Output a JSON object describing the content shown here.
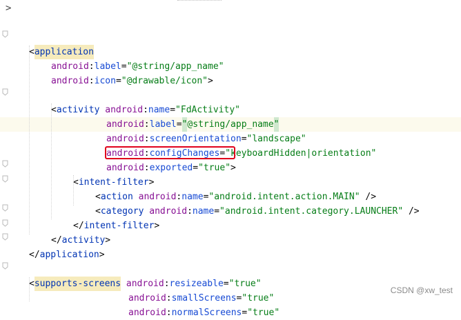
{
  "editor": {
    "collapsed_marker": ">",
    "lines": [
      {
        "indent": 0,
        "parts": []
      },
      {
        "indent": 0,
        "parts": [
          {
            "t": "br",
            "v": "<"
          },
          {
            "t": "tag hl",
            "v": "application"
          }
        ]
      },
      {
        "indent": 1,
        "parts": [
          {
            "t": "ns",
            "v": "android"
          },
          {
            "t": "br",
            "v": ":"
          },
          {
            "t": "attr",
            "v": "label"
          },
          {
            "t": "br",
            "v": "="
          },
          {
            "t": "val",
            "v": "\"@string/app_name\""
          }
        ]
      },
      {
        "indent": 1,
        "parts": [
          {
            "t": "ns",
            "v": "android"
          },
          {
            "t": "br",
            "v": ":"
          },
          {
            "t": "attr",
            "v": "icon"
          },
          {
            "t": "br",
            "v": "="
          },
          {
            "t": "val",
            "v": "\"@drawable/icon\""
          },
          {
            "t": "br",
            "v": ">"
          }
        ]
      },
      {
        "indent": 0,
        "parts": []
      },
      {
        "indent": 1,
        "parts": [
          {
            "t": "br",
            "v": "<"
          },
          {
            "t": "tag",
            "v": "activity"
          },
          {
            "t": "br",
            "v": " "
          },
          {
            "t": "ns",
            "v": "android"
          },
          {
            "t": "br",
            "v": ":"
          },
          {
            "t": "attr",
            "v": "name"
          },
          {
            "t": "br",
            "v": "="
          },
          {
            "t": "val",
            "v": "\"FdActivity\""
          }
        ]
      },
      {
        "indent": 1,
        "extra": 10,
        "current": true,
        "parts": [
          {
            "t": "ns",
            "v": "android"
          },
          {
            "t": "br",
            "v": ":"
          },
          {
            "t": "attr",
            "v": "label"
          },
          {
            "t": "br",
            "v": "="
          },
          {
            "t": "val brace",
            "v": "\""
          },
          {
            "t": "val",
            "v": "@string/app_name"
          },
          {
            "t": "val brace",
            "v": "\""
          }
        ]
      },
      {
        "indent": 1,
        "extra": 10,
        "parts": [
          {
            "t": "ns",
            "v": "android"
          },
          {
            "t": "br",
            "v": ":"
          },
          {
            "t": "attr",
            "v": "screenOrientation"
          },
          {
            "t": "br",
            "v": "="
          },
          {
            "t": "val",
            "v": "\"landscape\""
          }
        ]
      },
      {
        "indent": 1,
        "extra": 10,
        "parts": [
          {
            "t": "ns",
            "v": "android"
          },
          {
            "t": "br",
            "v": ":"
          },
          {
            "t": "attr",
            "v": "configChanges"
          },
          {
            "t": "br",
            "v": "="
          },
          {
            "t": "val",
            "v": "\"keyboardHidden|orientation\""
          }
        ]
      },
      {
        "indent": 1,
        "extra": 10,
        "parts": [
          {
            "t": "ns",
            "v": "android"
          },
          {
            "t": "br",
            "v": ":"
          },
          {
            "t": "attr",
            "v": "exported"
          },
          {
            "t": "br",
            "v": "="
          },
          {
            "t": "val",
            "v": "\"true\""
          },
          {
            "t": "br",
            "v": ">"
          }
        ]
      },
      {
        "indent": 2,
        "parts": [
          {
            "t": "br",
            "v": "<"
          },
          {
            "t": "tag",
            "v": "intent-filter"
          },
          {
            "t": "br",
            "v": ">"
          }
        ]
      },
      {
        "indent": 3,
        "parts": [
          {
            "t": "br",
            "v": "<"
          },
          {
            "t": "tag",
            "v": "action"
          },
          {
            "t": "br",
            "v": " "
          },
          {
            "t": "ns",
            "v": "android"
          },
          {
            "t": "br",
            "v": ":"
          },
          {
            "t": "attr",
            "v": "name"
          },
          {
            "t": "br",
            "v": "="
          },
          {
            "t": "val",
            "v": "\"android.intent.action.MAIN\""
          },
          {
            "t": "br",
            "v": " />"
          }
        ]
      },
      {
        "indent": 3,
        "parts": [
          {
            "t": "br",
            "v": "<"
          },
          {
            "t": "tag",
            "v": "category"
          },
          {
            "t": "br",
            "v": " "
          },
          {
            "t": "ns",
            "v": "android"
          },
          {
            "t": "br",
            "v": ":"
          },
          {
            "t": "attr",
            "v": "name"
          },
          {
            "t": "br",
            "v": "="
          },
          {
            "t": "val",
            "v": "\"android.intent.category.LAUNCHER\""
          },
          {
            "t": "br",
            "v": " />"
          }
        ]
      },
      {
        "indent": 2,
        "parts": [
          {
            "t": "br",
            "v": "</"
          },
          {
            "t": "tag",
            "v": "intent-filter"
          },
          {
            "t": "br",
            "v": ">"
          }
        ]
      },
      {
        "indent": 1,
        "parts": [
          {
            "t": "br",
            "v": "</"
          },
          {
            "t": "tag",
            "v": "activity"
          },
          {
            "t": "br",
            "v": ">"
          }
        ]
      },
      {
        "indent": 0,
        "parts": [
          {
            "t": "br",
            "v": "</"
          },
          {
            "t": "tag",
            "v": "application"
          },
          {
            "t": "br",
            "v": ">"
          }
        ]
      },
      {
        "indent": 0,
        "parts": []
      },
      {
        "indent": 0,
        "parts": [
          {
            "t": "br",
            "v": "<"
          },
          {
            "t": "tag hl",
            "v": "supports-screens"
          },
          {
            "t": "br",
            "v": " "
          },
          {
            "t": "ns",
            "v": "android"
          },
          {
            "t": "br",
            "v": ":"
          },
          {
            "t": "attr",
            "v": "resizeable"
          },
          {
            "t": "br",
            "v": "="
          },
          {
            "t": "val",
            "v": "\"true\""
          }
        ]
      },
      {
        "indent": 0,
        "extra": 18,
        "parts": [
          {
            "t": "ns",
            "v": "android"
          },
          {
            "t": "br",
            "v": ":"
          },
          {
            "t": "attr",
            "v": "smallScreens"
          },
          {
            "t": "br",
            "v": "="
          },
          {
            "t": "val",
            "v": "\"true\""
          }
        ]
      },
      {
        "indent": 0,
        "extra": 18,
        "parts": [
          {
            "t": "ns",
            "v": "android"
          },
          {
            "t": "br",
            "v": ":"
          },
          {
            "t": "attr",
            "v": "normalScreens"
          },
          {
            "t": "br",
            "v": "="
          },
          {
            "t": "val",
            "v": "\"true\""
          }
        ]
      }
    ]
  },
  "watermark": "CSDN @xw_test"
}
